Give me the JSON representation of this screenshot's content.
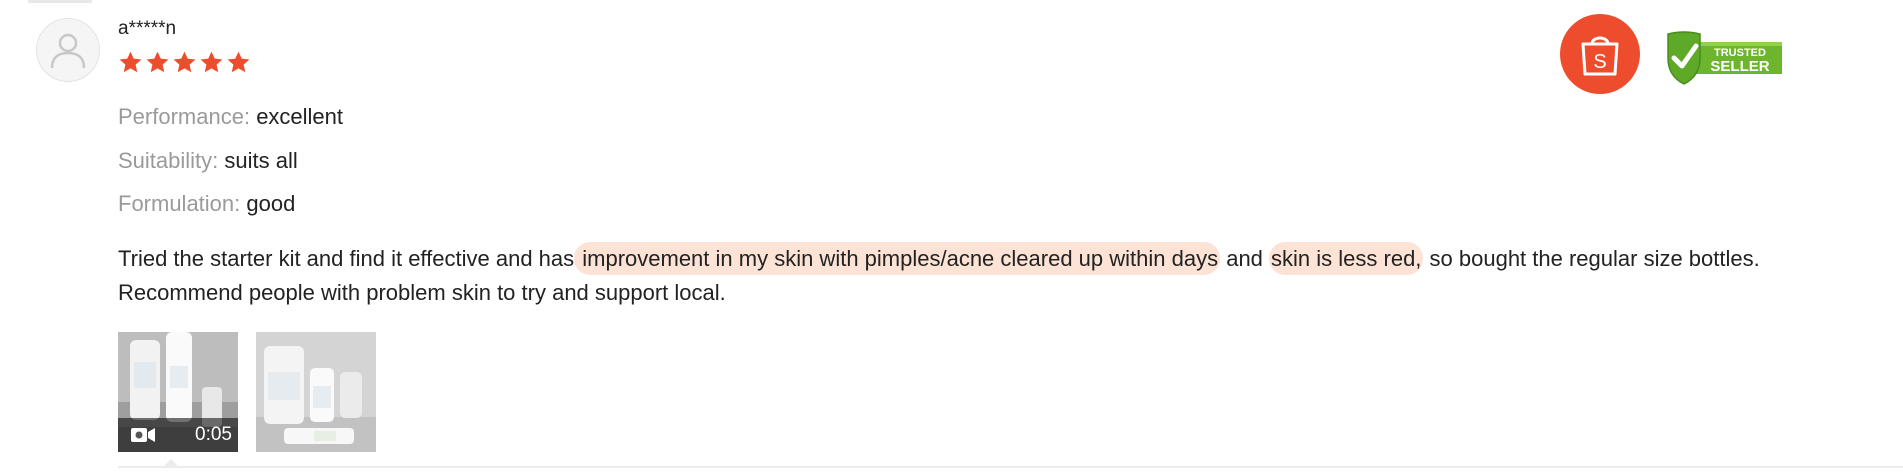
{
  "review": {
    "username": "a*****n",
    "rating": 5,
    "rating_max": 5,
    "attributes": [
      {
        "label": "Performance:",
        "value": "excellent"
      },
      {
        "label": "Suitability:",
        "value": "suits all"
      },
      {
        "label": "Formulation:",
        "value": "good"
      }
    ],
    "text": {
      "part1": "Tried the starter kit and find it effective and has",
      "highlight1": " improvement in my skin with pimples/acne cleared up within days",
      "part2": " and ",
      "highlight2": "skin is less red,",
      "part3": " so bought the regular size bottles. Recommend people with problem skin to try and support local."
    },
    "media": [
      {
        "type": "video",
        "duration": "0:05",
        "icon": "video-camera-icon"
      },
      {
        "type": "image"
      }
    ]
  },
  "badges": {
    "shop_logo_letter": "S",
    "trusted_line1": "TRUSTED",
    "trusted_line2": "SELLER"
  },
  "colors": {
    "star": "#ee4d2d",
    "highlight": "#fde3d6",
    "shop_brand": "#ee4d2d",
    "trusted_green": "#6cb52d",
    "label_gray": "#9a9a9a"
  }
}
